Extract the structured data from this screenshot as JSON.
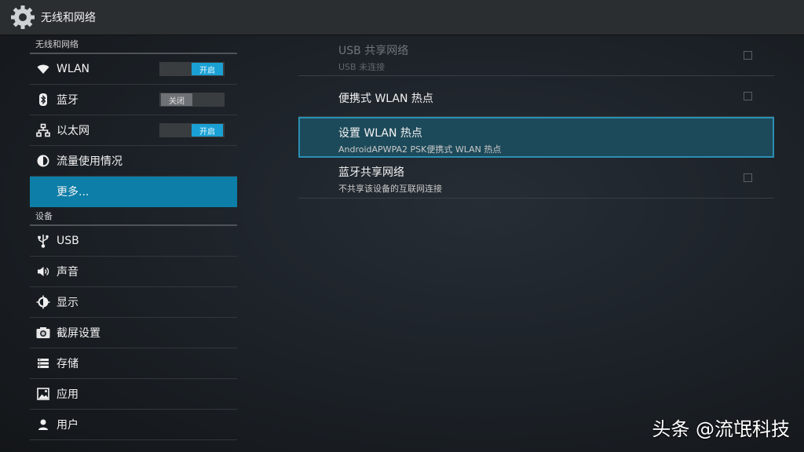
{
  "header": {
    "title": "无线和网络"
  },
  "sidebar": {
    "sections": [
      {
        "header": "无线和网络",
        "items": [
          {
            "label": "WLAN",
            "icon": "wifi-icon",
            "toggle": "开启"
          },
          {
            "label": "蓝牙",
            "icon": "bluetooth-icon",
            "toggle": "关闭"
          },
          {
            "label": "以太网",
            "icon": "ethernet-icon",
            "toggle": "开启"
          },
          {
            "label": "流量使用情况",
            "icon": "data-usage-icon"
          },
          {
            "label": "更多...",
            "selected": true
          }
        ]
      },
      {
        "header": "设备",
        "items": [
          {
            "label": "USB",
            "icon": "usb-icon"
          },
          {
            "label": "声音",
            "icon": "speaker-icon"
          },
          {
            "label": "显示",
            "icon": "display-icon"
          },
          {
            "label": "截屏设置",
            "icon": "camera-icon"
          },
          {
            "label": "存储",
            "icon": "storage-icon"
          },
          {
            "label": "应用",
            "icon": "apps-icon"
          },
          {
            "label": "用户",
            "icon": "user-icon"
          }
        ]
      }
    ]
  },
  "main": {
    "items": [
      {
        "title": "USB 共享网络",
        "subtitle": "USB 未连接",
        "disabled": true,
        "checkbox": false
      },
      {
        "title": "便携式 WLAN 热点",
        "checkbox": false
      },
      {
        "title": "设置 WLAN 热点",
        "subtitle": "AndroidAPWPA2 PSK便携式 WLAN 热点",
        "highlighted": true
      },
      {
        "title": "蓝牙共享网络",
        "subtitle": "不共享该设备的互联网连接",
        "checkbox": false
      }
    ]
  },
  "watermark": "头条 @流氓科技",
  "colors": {
    "accent": "#0c7ea8",
    "toggle_on": "#1aa0d4",
    "highlight": "#1d4a5a"
  }
}
